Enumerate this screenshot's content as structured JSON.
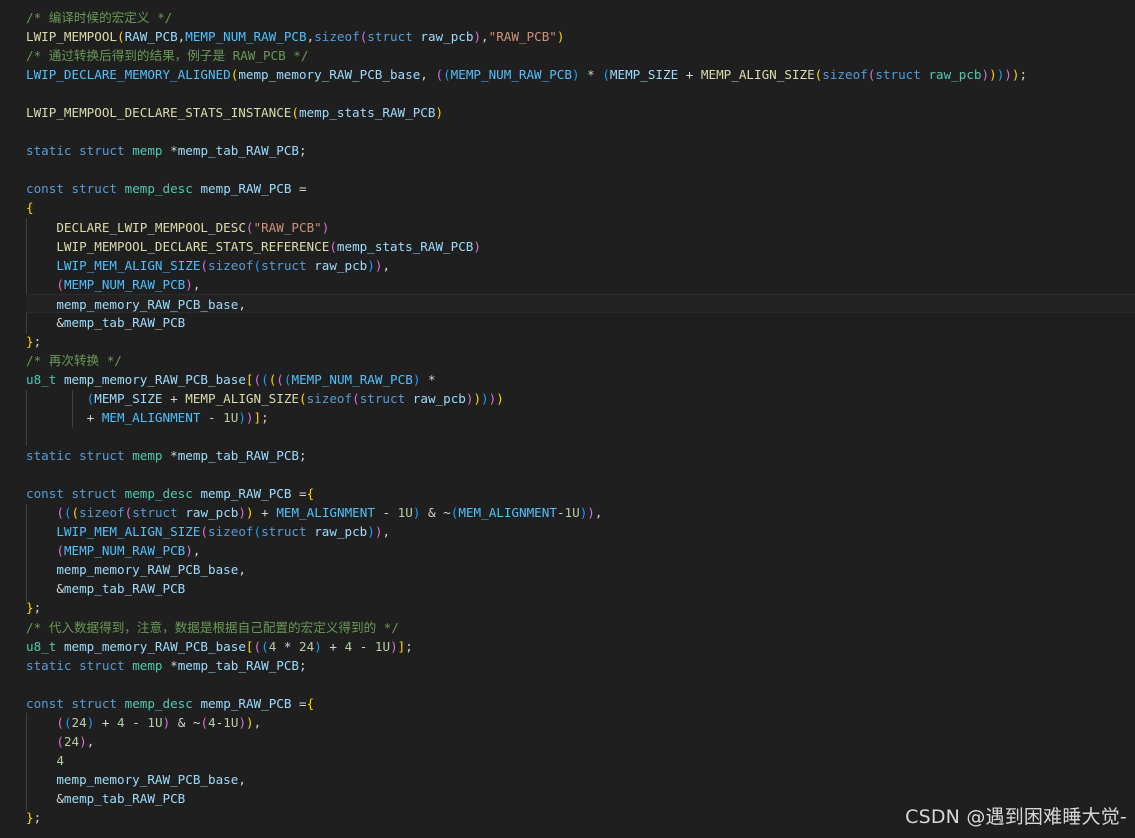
{
  "editor": {
    "lines": [
      [
        [
          "comment",
          "/* 编译时候的宏定义 */"
        ]
      ],
      [
        [
          "macro",
          "LWIP_MEMPOOL"
        ],
        [
          "b1",
          "("
        ],
        [
          "var",
          "RAW_PCB"
        ],
        [
          "plain",
          ","
        ],
        [
          "const",
          "MEMP_NUM_RAW_PCB"
        ],
        [
          "plain",
          ","
        ],
        [
          "keyword",
          "sizeof"
        ],
        [
          "b2",
          "("
        ],
        [
          "keyword",
          "struct"
        ],
        [
          "plain",
          " "
        ],
        [
          "var",
          "raw_pcb"
        ],
        [
          "b2",
          ")"
        ],
        [
          "plain",
          ","
        ],
        [
          "string",
          "\"RAW_PCB\""
        ],
        [
          "b1",
          ")"
        ]
      ],
      [
        [
          "comment",
          "/* 通过转换后得到的结果，例子是 RAW_PCB */"
        ]
      ],
      [
        [
          "const",
          "LWIP_DECLARE_MEMORY_ALIGNED"
        ],
        [
          "b1",
          "("
        ],
        [
          "var",
          "memp_memory_RAW_PCB_base"
        ],
        [
          "plain",
          ", "
        ],
        [
          "b2",
          "("
        ],
        [
          "b3",
          "("
        ],
        [
          "const",
          "MEMP_NUM_RAW_PCB"
        ],
        [
          "b3",
          ")"
        ],
        [
          "plain",
          " * "
        ],
        [
          "b3",
          "("
        ],
        [
          "var",
          "MEMP_SIZE"
        ],
        [
          "plain",
          " + "
        ],
        [
          "macro",
          "MEMP_ALIGN_SIZE"
        ],
        [
          "b1",
          "("
        ],
        [
          "keyword",
          "sizeof"
        ],
        [
          "b2",
          "("
        ],
        [
          "keyword",
          "struct"
        ],
        [
          "plain",
          " "
        ],
        [
          "type",
          "raw_pcb"
        ],
        [
          "b2",
          ")"
        ],
        [
          "b1",
          ")"
        ],
        [
          "b3",
          ")"
        ],
        [
          "b2",
          ")"
        ],
        [
          "b1",
          ")"
        ],
        [
          "plain",
          ";"
        ]
      ],
      [],
      [
        [
          "macro",
          "LWIP_MEMPOOL_DECLARE_STATS_INSTANCE"
        ],
        [
          "b1",
          "("
        ],
        [
          "var",
          "memp_stats_RAW_PCB"
        ],
        [
          "b1",
          ")"
        ]
      ],
      [],
      [
        [
          "keyword",
          "static"
        ],
        [
          "plain",
          " "
        ],
        [
          "keyword",
          "struct"
        ],
        [
          "plain",
          " "
        ],
        [
          "type",
          "memp"
        ],
        [
          "plain",
          " *"
        ],
        [
          "var",
          "memp_tab_RAW_PCB"
        ],
        [
          "plain",
          ";"
        ]
      ],
      [],
      [
        [
          "keyword",
          "const"
        ],
        [
          "plain",
          " "
        ],
        [
          "keyword",
          "struct"
        ],
        [
          "plain",
          " "
        ],
        [
          "type",
          "memp_desc"
        ],
        [
          "plain",
          " "
        ],
        [
          "var",
          "memp_RAW_PCB"
        ],
        [
          "plain",
          " ="
        ]
      ],
      [
        [
          "b1",
          "{"
        ]
      ],
      [
        [
          "plain",
          "    "
        ],
        [
          "macro",
          "DECLARE_LWIP_MEMPOOL_DESC"
        ],
        [
          "b2",
          "("
        ],
        [
          "string",
          "\"RAW_PCB\""
        ],
        [
          "b2",
          ")"
        ]
      ],
      [
        [
          "plain",
          "    "
        ],
        [
          "macro",
          "LWIP_MEMPOOL_DECLARE_STATS_REFERENCE"
        ],
        [
          "b2",
          "("
        ],
        [
          "var",
          "memp_stats_RAW_PCB"
        ],
        [
          "b2",
          ")"
        ]
      ],
      [
        [
          "plain",
          "    "
        ],
        [
          "const",
          "LWIP_MEM_ALIGN_SIZE"
        ],
        [
          "b2",
          "("
        ],
        [
          "keyword",
          "sizeof"
        ],
        [
          "b3",
          "("
        ],
        [
          "keyword",
          "struct"
        ],
        [
          "plain",
          " "
        ],
        [
          "var",
          "raw_pcb"
        ],
        [
          "b3",
          ")"
        ],
        [
          "b2",
          ")"
        ],
        [
          "plain",
          ","
        ]
      ],
      [
        [
          "plain",
          "    "
        ],
        [
          "b2",
          "("
        ],
        [
          "const",
          "MEMP_NUM_RAW_PCB"
        ],
        [
          "b2",
          ")"
        ],
        [
          "plain",
          ","
        ]
      ],
      [
        [
          "plain",
          "    "
        ],
        [
          "var",
          "memp_memory_RAW_PCB_base"
        ],
        [
          "plain",
          ","
        ]
      ],
      [
        [
          "plain",
          "    &"
        ],
        [
          "var",
          "memp_tab_RAW_PCB"
        ]
      ],
      [
        [
          "b1",
          "}"
        ],
        [
          "plain",
          ";"
        ]
      ],
      [
        [
          "comment",
          "/* 再次转换 */"
        ]
      ],
      [
        [
          "type",
          "u8_t"
        ],
        [
          "plain",
          " "
        ],
        [
          "var",
          "memp_memory_RAW_PCB_base"
        ],
        [
          "b1",
          "["
        ],
        [
          "b2",
          "("
        ],
        [
          "b3",
          "("
        ],
        [
          "b1",
          "("
        ],
        [
          "b2",
          "("
        ],
        [
          "b3",
          "("
        ],
        [
          "const",
          "MEMP_NUM_RAW_PCB"
        ],
        [
          "b3",
          ")"
        ],
        [
          "plain",
          " *"
        ]
      ],
      [
        [
          "plain",
          "        "
        ],
        [
          "b3",
          "("
        ],
        [
          "var",
          "MEMP_SIZE"
        ],
        [
          "plain",
          " + "
        ],
        [
          "macro",
          "MEMP_ALIGN_SIZE"
        ],
        [
          "b1",
          "("
        ],
        [
          "keyword",
          "sizeof"
        ],
        [
          "b2",
          "("
        ],
        [
          "keyword",
          "struct"
        ],
        [
          "plain",
          " "
        ],
        [
          "var",
          "raw_pcb"
        ],
        [
          "b2",
          ")"
        ],
        [
          "b1",
          ")"
        ],
        [
          "b3",
          ")"
        ],
        [
          "b2",
          ")"
        ],
        [
          "b1",
          ")"
        ]
      ],
      [
        [
          "plain",
          "        + "
        ],
        [
          "const",
          "MEM_ALIGNMENT"
        ],
        [
          "plain",
          " - "
        ],
        [
          "number",
          "1U"
        ],
        [
          "b3",
          ")"
        ],
        [
          "b2",
          ")"
        ],
        [
          "b1",
          "]"
        ],
        [
          "plain",
          ";"
        ]
      ],
      [],
      [
        [
          "keyword",
          "static"
        ],
        [
          "plain",
          " "
        ],
        [
          "keyword",
          "struct"
        ],
        [
          "plain",
          " "
        ],
        [
          "type",
          "memp"
        ],
        [
          "plain",
          " *"
        ],
        [
          "var",
          "memp_tab_RAW_PCB"
        ],
        [
          "plain",
          ";"
        ]
      ],
      [],
      [
        [
          "keyword",
          "const"
        ],
        [
          "plain",
          " "
        ],
        [
          "keyword",
          "struct"
        ],
        [
          "plain",
          " "
        ],
        [
          "type",
          "memp_desc"
        ],
        [
          "plain",
          " "
        ],
        [
          "var",
          "memp_RAW_PCB"
        ],
        [
          "plain",
          " ="
        ],
        [
          "b1",
          "{"
        ]
      ],
      [
        [
          "plain",
          "    "
        ],
        [
          "b2",
          "("
        ],
        [
          "b3",
          "("
        ],
        [
          "b1",
          "("
        ],
        [
          "keyword",
          "sizeof"
        ],
        [
          "b2",
          "("
        ],
        [
          "keyword",
          "struct"
        ],
        [
          "plain",
          " "
        ],
        [
          "var",
          "raw_pcb"
        ],
        [
          "b2",
          ")"
        ],
        [
          "b1",
          ")"
        ],
        [
          "plain",
          " + "
        ],
        [
          "const",
          "MEM_ALIGNMENT"
        ],
        [
          "plain",
          " - "
        ],
        [
          "number",
          "1U"
        ],
        [
          "b3",
          ")"
        ],
        [
          "plain",
          " & ~"
        ],
        [
          "b3",
          "("
        ],
        [
          "const",
          "MEM_ALIGNMENT"
        ],
        [
          "plain",
          "-"
        ],
        [
          "number",
          "1U"
        ],
        [
          "b3",
          ")"
        ],
        [
          "b2",
          ")"
        ],
        [
          "plain",
          ","
        ]
      ],
      [
        [
          "plain",
          "    "
        ],
        [
          "const",
          "LWIP_MEM_ALIGN_SIZE"
        ],
        [
          "b2",
          "("
        ],
        [
          "keyword",
          "sizeof"
        ],
        [
          "b3",
          "("
        ],
        [
          "keyword",
          "struct"
        ],
        [
          "plain",
          " "
        ],
        [
          "var",
          "raw_pcb"
        ],
        [
          "b3",
          ")"
        ],
        [
          "b2",
          ")"
        ],
        [
          "plain",
          ","
        ]
      ],
      [
        [
          "plain",
          "    "
        ],
        [
          "b2",
          "("
        ],
        [
          "const",
          "MEMP_NUM_RAW_PCB"
        ],
        [
          "b2",
          ")"
        ],
        [
          "plain",
          ","
        ]
      ],
      [
        [
          "plain",
          "    "
        ],
        [
          "var",
          "memp_memory_RAW_PCB_base"
        ],
        [
          "plain",
          ","
        ]
      ],
      [
        [
          "plain",
          "    &"
        ],
        [
          "var",
          "memp_tab_RAW_PCB"
        ]
      ],
      [
        [
          "b1",
          "}"
        ],
        [
          "plain",
          ";"
        ]
      ],
      [
        [
          "comment",
          "/* 代入数据得到，注意，数据是根据自己配置的宏定义得到的 */"
        ]
      ],
      [
        [
          "type",
          "u8_t"
        ],
        [
          "plain",
          " "
        ],
        [
          "var",
          "memp_memory_RAW_PCB_base"
        ],
        [
          "b1",
          "["
        ],
        [
          "b2",
          "("
        ],
        [
          "b3",
          "("
        ],
        [
          "number",
          "4"
        ],
        [
          "plain",
          " * "
        ],
        [
          "number",
          "24"
        ],
        [
          "b3",
          ")"
        ],
        [
          "plain",
          " + "
        ],
        [
          "number",
          "4"
        ],
        [
          "plain",
          " - "
        ],
        [
          "number",
          "1U"
        ],
        [
          "b2",
          ")"
        ],
        [
          "b1",
          "]"
        ],
        [
          "plain",
          ";"
        ]
      ],
      [
        [
          "keyword",
          "static"
        ],
        [
          "plain",
          " "
        ],
        [
          "keyword",
          "struct"
        ],
        [
          "plain",
          " "
        ],
        [
          "type",
          "memp"
        ],
        [
          "plain",
          " *"
        ],
        [
          "var",
          "memp_tab_RAW_PCB"
        ],
        [
          "plain",
          ";"
        ]
      ],
      [],
      [
        [
          "keyword",
          "const"
        ],
        [
          "plain",
          " "
        ],
        [
          "keyword",
          "struct"
        ],
        [
          "plain",
          " "
        ],
        [
          "type",
          "memp_desc"
        ],
        [
          "plain",
          " "
        ],
        [
          "var",
          "memp_RAW_PCB"
        ],
        [
          "plain",
          " ="
        ],
        [
          "b1",
          "{"
        ]
      ],
      [
        [
          "plain",
          "    "
        ],
        [
          "b2",
          "("
        ],
        [
          "b3",
          "("
        ],
        [
          "number",
          "24"
        ],
        [
          "b3",
          ")"
        ],
        [
          "plain",
          " + "
        ],
        [
          "number",
          "4"
        ],
        [
          "plain",
          " - "
        ],
        [
          "number",
          "1U"
        ],
        [
          "b2",
          ")"
        ],
        [
          "plain",
          " & ~"
        ],
        [
          "b2",
          "("
        ],
        [
          "number",
          "4"
        ],
        [
          "plain",
          "-"
        ],
        [
          "number",
          "1U"
        ],
        [
          "b2",
          ")"
        ],
        [
          "b1",
          ")"
        ],
        [
          "plain",
          ","
        ]
      ],
      [
        [
          "plain",
          "    "
        ],
        [
          "b2",
          "("
        ],
        [
          "number",
          "24"
        ],
        [
          "b2",
          ")"
        ],
        [
          "plain",
          ","
        ]
      ],
      [
        [
          "plain",
          "    "
        ],
        [
          "number",
          "4"
        ]
      ],
      [
        [
          "plain",
          "    "
        ],
        [
          "var",
          "memp_memory_RAW_PCB_base"
        ],
        [
          "plain",
          ","
        ]
      ],
      [
        [
          "plain",
          "    &"
        ],
        [
          "var",
          "memp_tab_RAW_PCB"
        ]
      ],
      [
        [
          "b1",
          "}"
        ],
        [
          "plain",
          ";"
        ]
      ]
    ],
    "current_line": 15
  },
  "watermark": "CSDN @遇到困难睡大觉-",
  "colors": {
    "background": "#1f1f1f",
    "comment": "#6a9955",
    "keyword": "#569cd6",
    "type": "#4ec9b0",
    "macro": "#dcdcaa",
    "variable": "#9cdcfe",
    "string": "#ce9178",
    "number": "#b5cea8",
    "constant": "#4fc1ff"
  }
}
